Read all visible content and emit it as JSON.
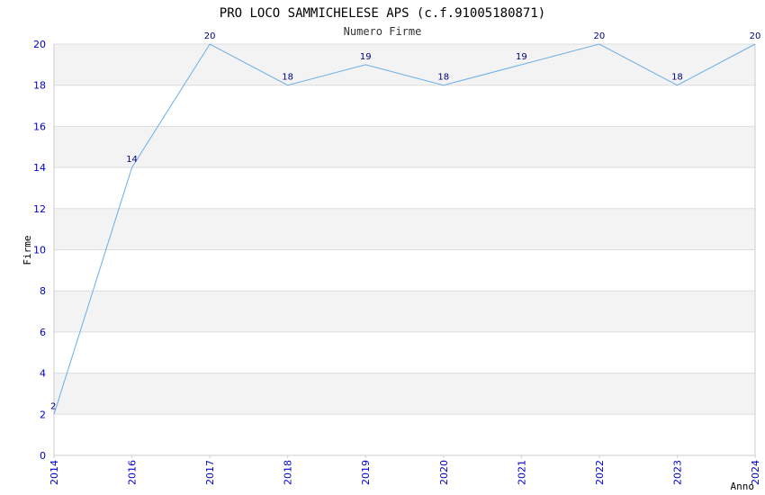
{
  "chart_data": {
    "type": "line",
    "title": "PRO LOCO SAMMICHELESE APS (c.f.91005180871)",
    "subtitle": "Numero Firme",
    "xlabel": "Anno",
    "ylabel": "Firme",
    "categories": [
      "2014",
      "2016",
      "2017",
      "2018",
      "2019",
      "2020",
      "2021",
      "2022",
      "2023",
      "2024"
    ],
    "series": [
      {
        "values": [
          2,
          14,
          20,
          18,
          19,
          18,
          19,
          20,
          18,
          20
        ]
      }
    ],
    "ylim": [
      0,
      20
    ],
    "yticks": [
      0,
      2,
      4,
      6,
      8,
      10,
      12,
      14,
      16,
      18,
      20
    ],
    "grid": true,
    "colors": {
      "line": "#6aaee8",
      "band": "#f3f3f3",
      "grid": "#dddddd",
      "tick": "#0000cc",
      "label": "#000080"
    }
  }
}
